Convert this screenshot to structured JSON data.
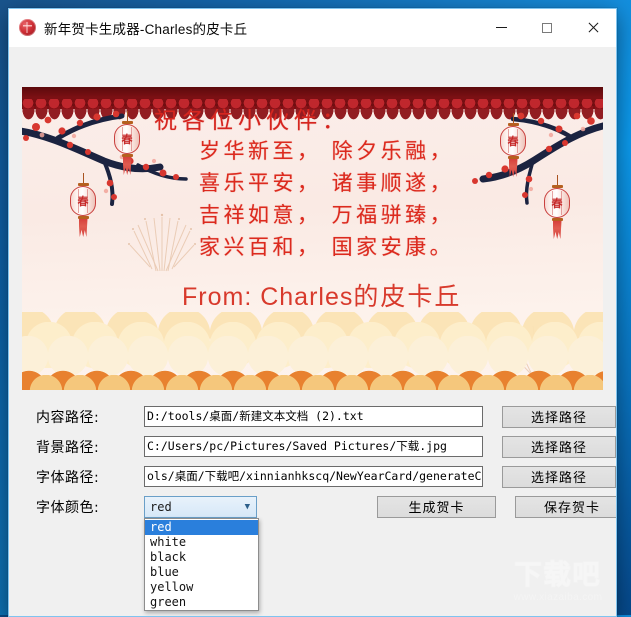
{
  "window": {
    "title": "新年贺卡生成器-Charles的皮卡丘",
    "icon": "app-red-seal-icon",
    "controls": {
      "minimize": "—",
      "maximize": "☐",
      "close": "✕"
    }
  },
  "card": {
    "greeting_title": "祝各位小伙伴：",
    "verses": [
      "岁华新至， 除夕乐融，",
      "喜乐平安， 诸事顺遂，",
      "吉祥如意， 万福骈臻，",
      "家兴百和， 国家安康。"
    ],
    "from_prefix": "From: Charles",
    "from_name": "的皮卡丘",
    "lantern_char": "春",
    "text_color": "#d6251f",
    "background_color": "#fbeeea",
    "border_color": "#7d1014",
    "cloud_color": "#fbe3b4",
    "arc_color": "#e8812f"
  },
  "form": {
    "rows": [
      {
        "label": "内容路径:",
        "value": "D:/tools/桌面/新建文本文档 (2).txt",
        "button": "选择路径"
      },
      {
        "label": "背景路径:",
        "value": "C:/Users/pc/Pictures/Saved Pictures/下载.jpg",
        "button": "选择路径"
      },
      {
        "label": "字体路径:",
        "value": "ols/桌面/下载吧/xinnianhkscq/NewYearCard/generateCard.exe",
        "button": "选择路径"
      }
    ],
    "color_row": {
      "label": "字体颜色:",
      "selected": "red",
      "options": [
        "red",
        "white",
        "black",
        "blue",
        "yellow",
        "green"
      ],
      "dropdown_open": true,
      "generate_button": "生成贺卡",
      "save_button": "保存贺卡"
    }
  },
  "watermark": {
    "logo": "下载吧",
    "url": "www.xiazaiba.com"
  }
}
